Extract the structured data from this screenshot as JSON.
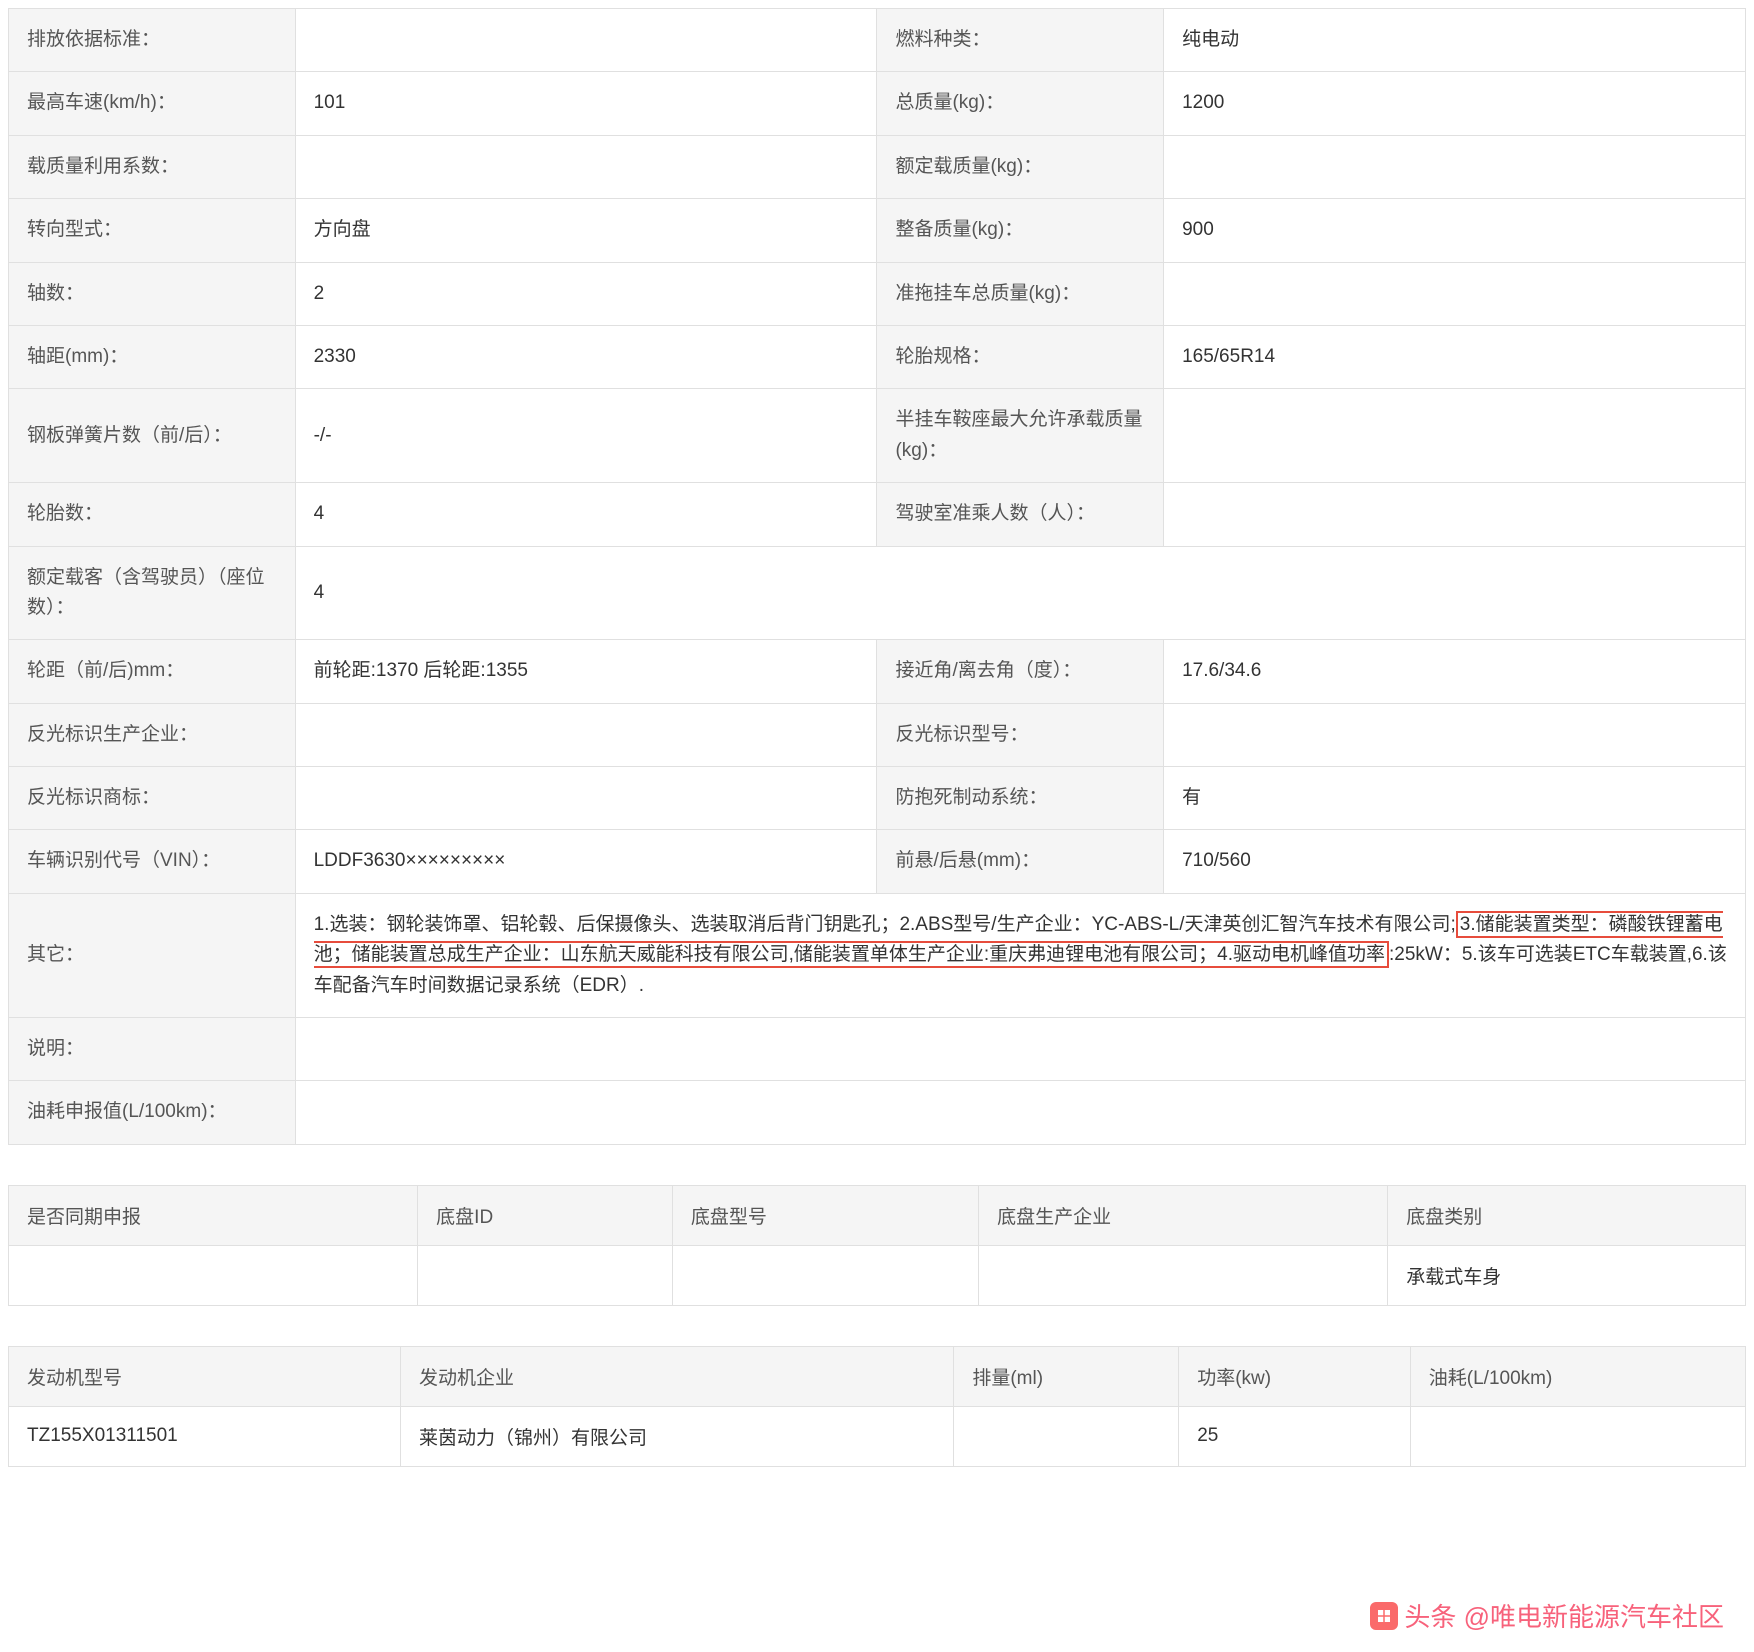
{
  "specs": {
    "r1": {
      "l1": "排放依据标准：",
      "v1": "",
      "l2": "燃料种类：",
      "v2": "纯电动"
    },
    "r2": {
      "l1": "最高车速(km/h)：",
      "v1": "101",
      "l2": "总质量(kg)：",
      "v2": "1200"
    },
    "r3": {
      "l1": "载质量利用系数：",
      "v1": "",
      "l2": "额定载质量(kg)：",
      "v2": ""
    },
    "r4": {
      "l1": "转向型式：",
      "v1": "方向盘",
      "l2": "整备质量(kg)：",
      "v2": "900"
    },
    "r5": {
      "l1": "轴数：",
      "v1": "2",
      "l2": "准拖挂车总质量(kg)：",
      "v2": ""
    },
    "r6": {
      "l1": "轴距(mm)：",
      "v1": "2330",
      "l2": "轮胎规格：",
      "v2": "165/65R14"
    },
    "r7": {
      "l1": "钢板弹簧片数（前/后）：",
      "v1": "-/-",
      "l2": "半挂车鞍座最大允许承载质量(kg)：",
      "v2": ""
    },
    "r8": {
      "l1": "轮胎数：",
      "v1": "4",
      "l2": "驾驶室准乘人数（人）：",
      "v2": ""
    },
    "r9": {
      "l1": "额定载客（含驾驶员）（座位数）：",
      "v1": "4"
    },
    "r10": {
      "l1": "轮距（前/后)mm：",
      "v1": "前轮距:1370 后轮距:1355",
      "l2": "接近角/离去角（度）：",
      "v2": "17.6/34.6"
    },
    "r11": {
      "l1": "反光标识生产企业：",
      "v1": "",
      "l2": "反光标识型号：",
      "v2": ""
    },
    "r12": {
      "l1": "反光标识商标：",
      "v1": "",
      "l2": "防抱死制动系统：",
      "v2": "有"
    },
    "r13": {
      "l1": "车辆识别代号（VIN）：",
      "v1": "LDDF3630×××××××××",
      "l2": "前悬/后悬(mm)：",
      "v2": "710/560"
    },
    "r14": {
      "l1": "其它：",
      "pre": "1.选装：钢轮装饰罩、铝轮毂、后保摄像头、选装取消后背门钥匙孔；2.ABS型号/生产企业：YC-ABS-L/天津英创汇智汽车技术有限公司;",
      "hl": "3.储能装置类型：磷酸铁锂蓄电池；储能装置总成生产企业：山东航天威能科技有限公司,储能装置单体生产企业:重庆弗迪锂电池有限公司；4.驱动电机峰值功率",
      "post": ":25kW：5.该车可选装ETC车载装置,6.该车配备汽车时间数据记录系统（EDR）."
    },
    "r15": {
      "l1": "说明：",
      "v1": ""
    },
    "r16": {
      "l1": "油耗申报值(L/100km)：",
      "v1": ""
    }
  },
  "chassis": {
    "headers": [
      "是否同期申报",
      "底盘ID",
      "底盘型号",
      "底盘生产企业",
      "底盘类别"
    ],
    "row": {
      "c1": "",
      "c2": "",
      "c3": "",
      "c4": "",
      "c5": "承载式车身"
    }
  },
  "engine": {
    "headers": [
      "发动机型号",
      "发动机企业",
      "排量(ml)",
      "功率(kw)",
      "油耗(L/100km)"
    ],
    "row": {
      "c1": "TZ155X01311501",
      "c2": "莱茵动力（锦州）有限公司",
      "c3": "",
      "c4": "25",
      "c5": ""
    }
  },
  "watermark": {
    "text": "头条 @唯电新能源汽车社区"
  }
}
